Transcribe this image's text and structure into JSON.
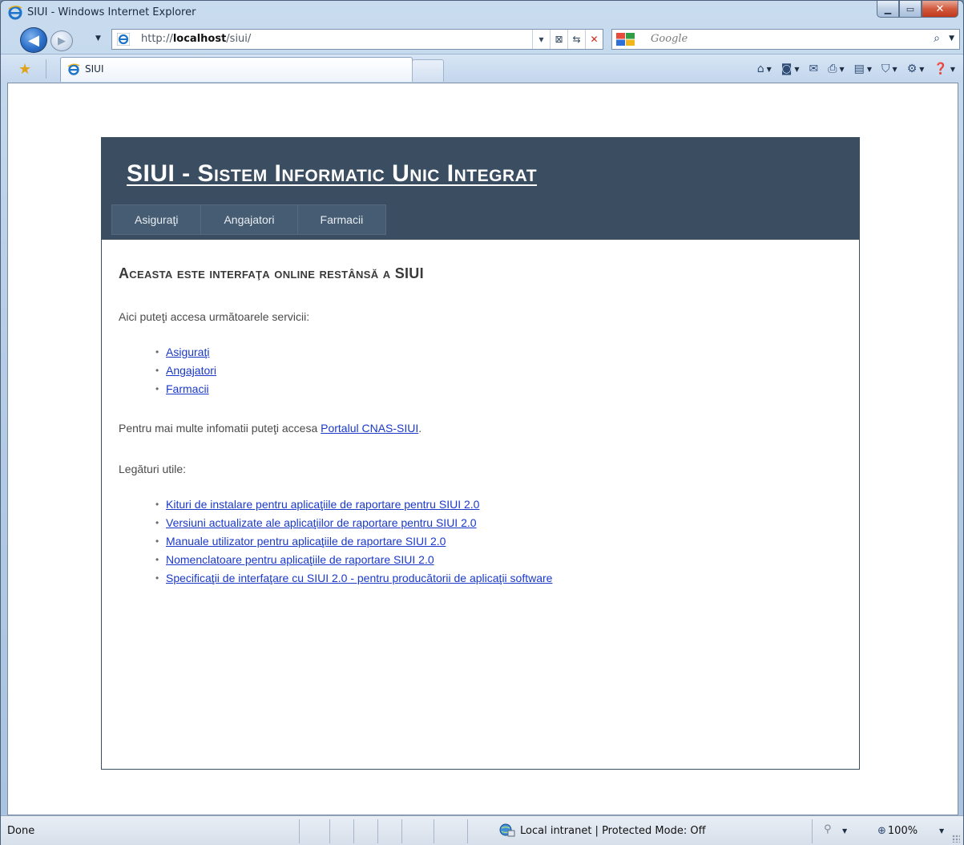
{
  "window": {
    "title": "SIUI - Windows Internet Explorer"
  },
  "navigation": {
    "address_host_prefix": "http://",
    "address_host": "localhost",
    "address_path": "/siui/",
    "search_placeholder": "Google"
  },
  "tabs": [
    {
      "label": "SIUI",
      "active": true
    }
  ],
  "site": {
    "title": "SIUI - Sistem Informatic Unic Integrat",
    "menu": [
      "Asiguraţi",
      "Angajatori",
      "Farmacii"
    ],
    "heading": "Aceasta este interfaţa online restânsă a SIUI",
    "intro": "Aici puteţi accesa următoarele servicii:",
    "services": [
      "Asiguraţi",
      "Angajatori",
      "Farmacii"
    ],
    "more_info_text": "Pentru mai multe infomatii puteţi accesa ",
    "more_info_link": "Portalul CNAS-SIUI",
    "more_info_end": ".",
    "useful_links_label": "Legături utile:",
    "useful_links": [
      "Kituri de instalare pentru aplicaţiile de raportare pentru SIUI 2.0",
      "Versiuni actualizate ale aplicaţiilor de raportare pentru SIUI 2.0",
      "Manuale utilizator pentru aplicaţiile de raportare SIUI 2.0",
      "Nomenclatoare pentru aplicaţiile de raportare SIUI 2.0",
      "Specificaţii de interfaţare cu SIUI 2.0 - pentru producătorii de aplicaţii software"
    ]
  },
  "status": {
    "text": "Done",
    "zone": "Local intranet | Protected Mode: Off",
    "zoom": "100%"
  },
  "colors": {
    "header_bg": "#3a4d61",
    "link": "#1a39c9"
  }
}
